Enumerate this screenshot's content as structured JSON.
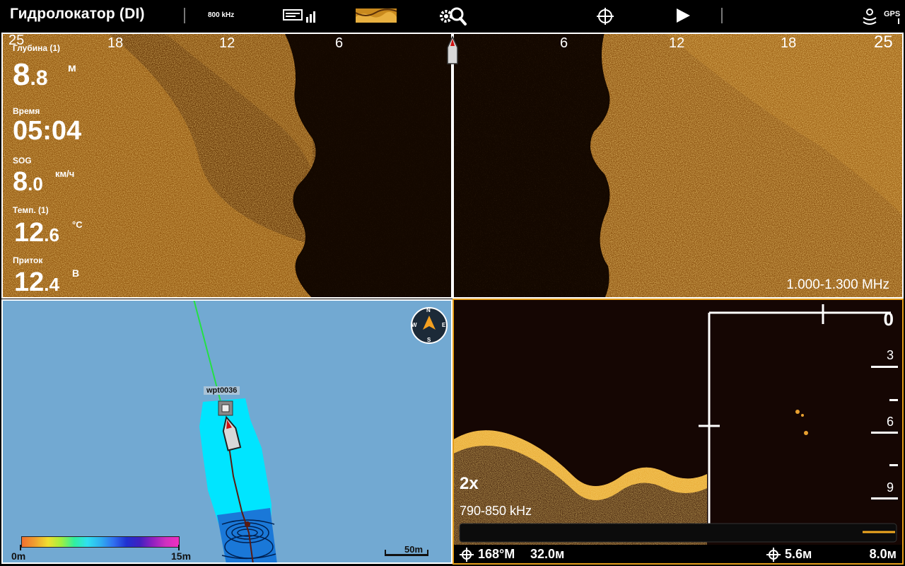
{
  "topbar": {
    "title": "Гидролокатор (DI)",
    "frequency": "800 kHz",
    "icons": [
      "sonar-view-icon",
      "chart-thumb-icon",
      "settings-search-icon",
      "crosshair-icon",
      "play-icon",
      "gps-status-icon"
    ],
    "gps_label": "GPS"
  },
  "side_imaging": {
    "range_left": [
      "25",
      "18",
      "12",
      "6"
    ],
    "range_right": [
      "6",
      "12",
      "18",
      "25"
    ],
    "frequency": "1.000-1.300 MHz"
  },
  "digital_readouts": [
    {
      "label": "Глубина (1)",
      "value_int": "8",
      "value_dec": ".8",
      "unit": "м"
    },
    {
      "label": "Время",
      "value_int": "05:04",
      "value_dec": "",
      "unit": ""
    },
    {
      "label": "SOG",
      "value_int": "8",
      "value_dec": ".0",
      "unit": "км/ч"
    },
    {
      "label": "Темп. (1)",
      "value_int": "12",
      "value_dec": ".6",
      "unit": "°C"
    },
    {
      "label": "Приток",
      "value_int": "12",
      "value_dec": ".4",
      "unit": "В"
    }
  ],
  "map": {
    "waypoint": "wpt0036",
    "compass": {
      "n": "N",
      "e": "E",
      "s": "S",
      "w": "W"
    },
    "scale_start": "0m",
    "scale_end": "15m",
    "distance_scale": "50m"
  },
  "down_imaging": {
    "zoom": "2x",
    "frequency": "790-850 kHz",
    "depth_scale": [
      "0",
      "3",
      "6",
      "9"
    ],
    "cursor_bearing": "168°M",
    "cursor_distance": "32.0м",
    "cursor_depth": "5.6м",
    "bottom_depth": "8.0м"
  },
  "colors": {
    "sonar_gold": "#e0a030",
    "sonar_dark": "#140800",
    "water_blue": "#72a9d2",
    "track_cyan": "#00e5ff",
    "active_border": "#e59e1a"
  }
}
